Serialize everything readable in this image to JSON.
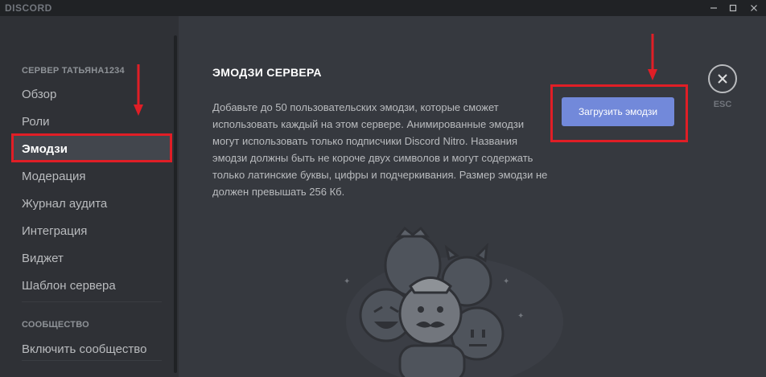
{
  "app": {
    "brand": "DISCORD"
  },
  "window": {
    "minimize": "—",
    "maximize": "☐",
    "close": "✕"
  },
  "sidebar": {
    "section_server": "СЕРВЕР ТАТЬЯНА1234",
    "items": [
      {
        "label": "Обзор"
      },
      {
        "label": "Роли"
      },
      {
        "label": "Эмодзи",
        "selected": true
      },
      {
        "label": "Модерация"
      },
      {
        "label": "Журнал аудита"
      },
      {
        "label": "Интеграция"
      },
      {
        "label": "Виджет"
      },
      {
        "label": "Шаблон сервера"
      }
    ],
    "section_community": "СООБЩЕСТВО",
    "community_items": [
      {
        "label": "Включить сообщество"
      }
    ]
  },
  "main": {
    "title": "ЭМОДЗИ СЕРВЕРА",
    "description": "Добавьте до 50 пользовательских эмодзи, которые сможет использовать каждый на этом сервере. Анимированные эмодзи могут использовать только подписчики Discord Nitro. Названия эмодзи должны быть не короче двух символов и могут содержать только латинские буквы, цифры и подчеркивания. Размер эмодзи не должен превышать 256 Кб.",
    "upload_button": "Загрузить эмодзи",
    "esc_label": "ESC"
  },
  "colors": {
    "accent": "#7289da",
    "annotation": "#e01e26",
    "sidebar_bg": "#2f3136",
    "main_bg": "#36393f"
  },
  "icons": {
    "close": "close-icon",
    "arrow": "arrow-down-icon"
  }
}
